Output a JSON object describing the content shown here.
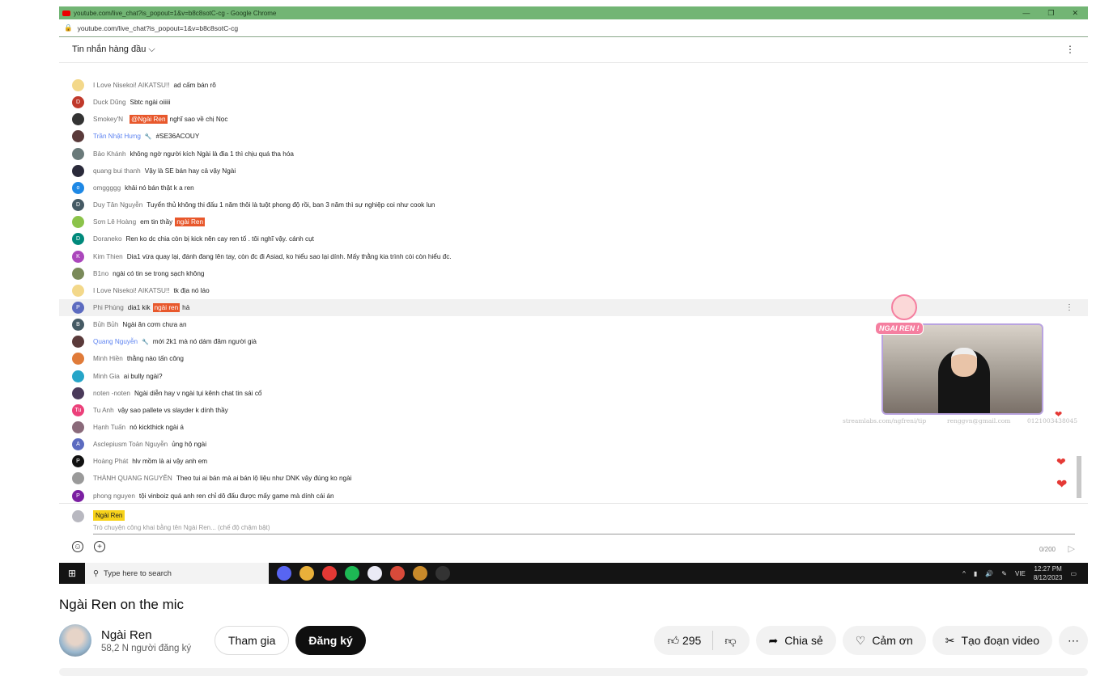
{
  "window": {
    "title": "youtube.com/live_chat?is_popout=1&v=b8c8sotC-cg - Google Chrome",
    "url": "youtube.com/live_chat?is_popout=1&v=b8c8sotC-cg",
    "minimize": "—",
    "maximize": "❐",
    "close": "✕"
  },
  "chat": {
    "mode_label": "Tin nhắn hàng đầu",
    "menu_icon": "kebab-icon",
    "messages": [
      {
        "author": "I Love Nisekoi! AIKATSU!!",
        "text": "ad cấm bán rõ",
        "color": "#f3d88a",
        "initial": ""
      },
      {
        "author": "Duck Dũng",
        "text": "Sbtc ngài oiiiii",
        "color": "#c0392b",
        "initial": "D"
      },
      {
        "author": "Smokey'N",
        "mention": "@Ngài Ren",
        "text": "nghĩ sao về chị Nọc",
        "color": "#333333",
        "initial": ""
      },
      {
        "author": "Trần Nhật Hưng",
        "mod": true,
        "text": "#SE36ACOUY",
        "color": "#5a3a3a",
        "initial": ""
      },
      {
        "author": "Bảo Khánh",
        "text": "không ngờ người kích Ngài là đia 1 thì chịu quá tha hóa",
        "color": "#6a7a7a",
        "initial": ""
      },
      {
        "author": "quang bui thanh",
        "text": "Vậy là SE bán hay cả vậy Ngài",
        "color": "#2a2a3a",
        "initial": ""
      },
      {
        "author": "omggggg",
        "text": "khải nó bán thật k a ren",
        "color": "#1e88e5",
        "initial": "o"
      },
      {
        "author": "Duy Tân Nguyễn",
        "text": "Tuyển thủ không thi đấu 1 năm thôi là tuột phong độ rồi, ban 3 năm thì sự nghiệp coi như cook lun",
        "color": "#455a64",
        "initial": "D"
      },
      {
        "author": "Sơn Lê Hoàng",
        "text": "em tin thầy",
        "mention_after": "ngài Ren",
        "color": "#8bc34a",
        "initial": ""
      },
      {
        "author": "Doraneko",
        "text": "Ren ko dc chia còn bị kick nên cay ren tố . tôi nghĩ vậy. cánh cụt",
        "color": "#00897b",
        "initial": "D"
      },
      {
        "author": "Kim Thien",
        "text": "Dia1 vừa quay lại, đánh đang lên tay, còn đc đi Asiad, ko hiểu sao lại dính. Mấy thằng kia trình còi còn hiểu đc.",
        "color": "#ab47bc",
        "initial": "K"
      },
      {
        "author": "B1no",
        "text": "ngài có tin se trong sạch không",
        "color": "#7a8a5a",
        "initial": ""
      },
      {
        "author": "I Love Nisekoi! AIKATSU!!",
        "text": "tk địa nó láo",
        "color": "#f3d88a",
        "initial": ""
      },
      {
        "author": "Phi Phùng",
        "text": "dia1 kik",
        "mention_after": "ngài ren",
        "text_after": "hả",
        "color": "#5c6bc0",
        "initial": "P",
        "highlighted": true
      },
      {
        "author": "Bủh Bủh",
        "text": "Ngài ăn cơm chưa an",
        "color": "#455a64",
        "initial": "B"
      },
      {
        "author": "Quang Nguyễn",
        "mod": true,
        "text": "mới 2k1 mà nó dám đâm người già",
        "color": "#5a3a3a",
        "initial": ""
      },
      {
        "author": "Minh Hiền",
        "text": "thằng nào tấn công",
        "color": "#e07b39",
        "initial": ""
      },
      {
        "author": "Minh Gia",
        "text": "ai bully ngài?",
        "color": "#26a5c8",
        "initial": ""
      },
      {
        "author": "noten -noten",
        "text": "Ngài diễn hay v ngài tụi kênh chat tin sái cổ",
        "color": "#4a3a5a",
        "initial": ""
      },
      {
        "author": "Tu Anh",
        "text": "vậy sao pallete vs slayder k dính thầy",
        "color": "#ec407a",
        "initial": "Tu"
      },
      {
        "author": "Hạnh Tuấn",
        "text": "nó kickthick ngài á",
        "color": "#8a6a7a",
        "initial": ""
      },
      {
        "author": "Asclepiusm Toản Nguyễn",
        "text": "ủng hộ ngài",
        "color": "#5c6bc0",
        "initial": "A"
      },
      {
        "author": "Hoàng Phát",
        "text": "hlv mồm là ai vậy anh em",
        "color": "#111111",
        "initial": "P"
      },
      {
        "author": "THÀNH QUANG NGUYỄN",
        "text": "Theo tui ai bán mà ai bán lộ liệu như DNK vậy đúng ko ngài",
        "color": "#9a9a9a",
        "initial": ""
      },
      {
        "author": "phong nguyen",
        "text": "tội vinboiz quá anh ren chỉ dô đấu được mấy game mà dính cái án",
        "color": "#7b1fa2",
        "initial": "P"
      }
    ],
    "compose": {
      "user": "Ngài Ren",
      "placeholder": "Trò chuyện công khai bằng tên Ngài Ren... (chế độ chậm bật)",
      "counter": "0/200"
    }
  },
  "overlay": {
    "sticker": "NGAI REN !",
    "info": [
      "streamlabs.com/ngfreni/tip",
      "renggvn@gmail.com",
      "0121003438045"
    ]
  },
  "taskbar": {
    "search_placeholder": "Type here to search",
    "lang": "VIE",
    "time": "12:27 PM",
    "date": "8/12/2023",
    "apps": [
      {
        "name": "discord",
        "color": "#5865f2"
      },
      {
        "name": "chrome",
        "color": "#e8b03a"
      },
      {
        "name": "app-red",
        "color": "#e53935"
      },
      {
        "name": "spotify",
        "color": "#1db954"
      },
      {
        "name": "zalo",
        "color": "#eaeaf5"
      },
      {
        "name": "chrome-2",
        "color": "#d84a3a"
      },
      {
        "name": "league",
        "color": "#c98a2a"
      },
      {
        "name": "app-gauge",
        "color": "#333"
      }
    ]
  },
  "video": {
    "title": "Ngài Ren on the mic",
    "channel": "Ngài Ren",
    "subscribers": "58,2 N người đăng ký",
    "join": "Tham gia",
    "subscribe": "Đăng ký",
    "likes": "295",
    "share": "Chia sẻ",
    "thanks": "Cảm ơn",
    "clip": "Tạo đoạn video",
    "more": "⋯"
  }
}
